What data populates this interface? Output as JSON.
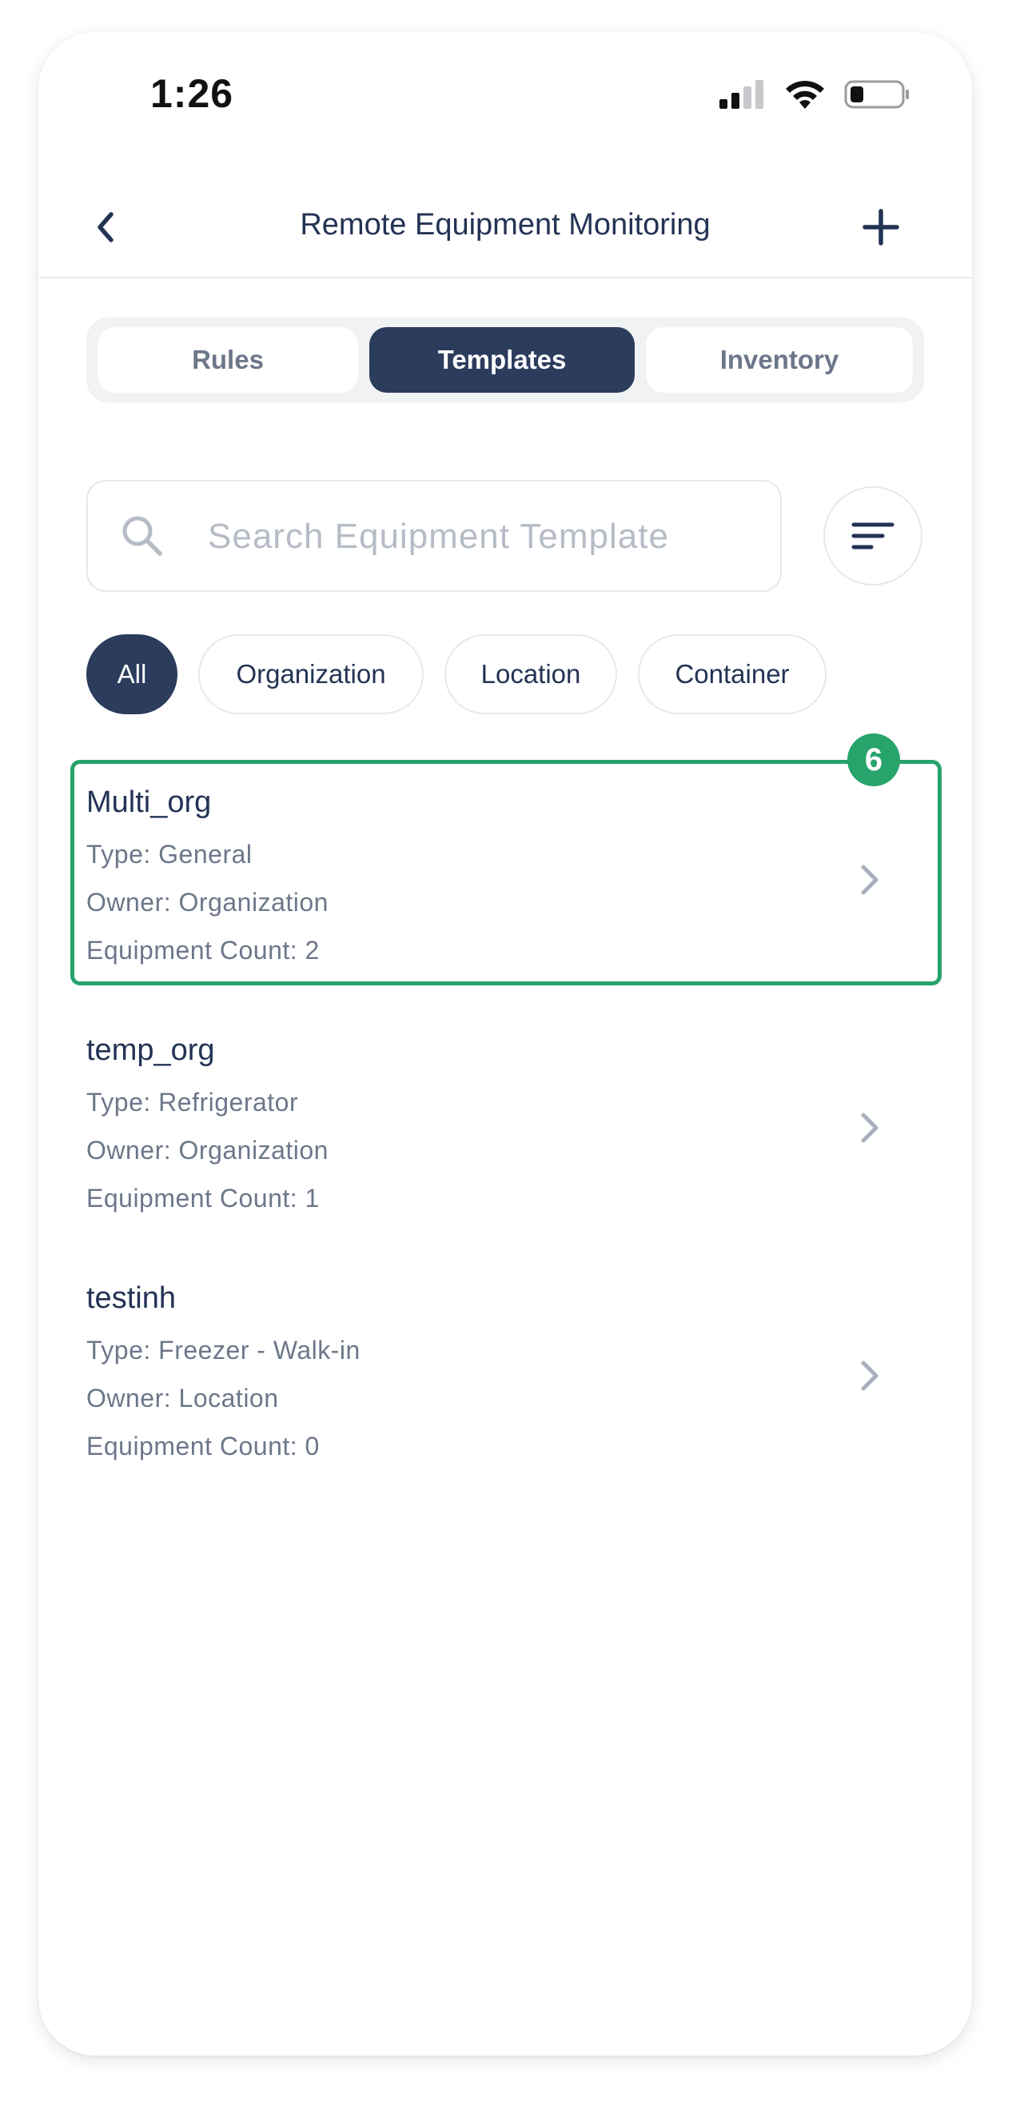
{
  "status_bar": {
    "time": "1:26"
  },
  "header": {
    "title": "Remote Equipment Monitoring",
    "back_icon": "chevron-left-icon",
    "add_icon": "plus-icon"
  },
  "tabs": [
    {
      "label": "Rules",
      "selected": false
    },
    {
      "label": "Templates",
      "selected": true
    },
    {
      "label": "Inventory",
      "selected": false
    }
  ],
  "search": {
    "placeholder": "Search Equipment Template",
    "value": ""
  },
  "filters": [
    {
      "label": "All",
      "selected": true
    },
    {
      "label": "Organization",
      "selected": false
    },
    {
      "label": "Location",
      "selected": false
    },
    {
      "label": "Container",
      "selected": false
    }
  ],
  "templates": [
    {
      "name": "Multi_org",
      "type": "Type: General",
      "owner": "Owner: Organization",
      "count": "Equipment Count: 2"
    },
    {
      "name": "temp_org",
      "type": "Type: Refrigerator",
      "owner": "Owner: Organization",
      "count": "Equipment Count: 1"
    },
    {
      "name": "testinh",
      "type": "Type: Freezer - Walk-in",
      "owner": "Owner: Location",
      "count": "Equipment Count: 0"
    }
  ],
  "highlight": {
    "badge": "6"
  },
  "colors": {
    "primary": "#2b3c5c",
    "highlight": "#27a36c",
    "text_dark": "#233354",
    "text_muted": "#6d778a"
  }
}
